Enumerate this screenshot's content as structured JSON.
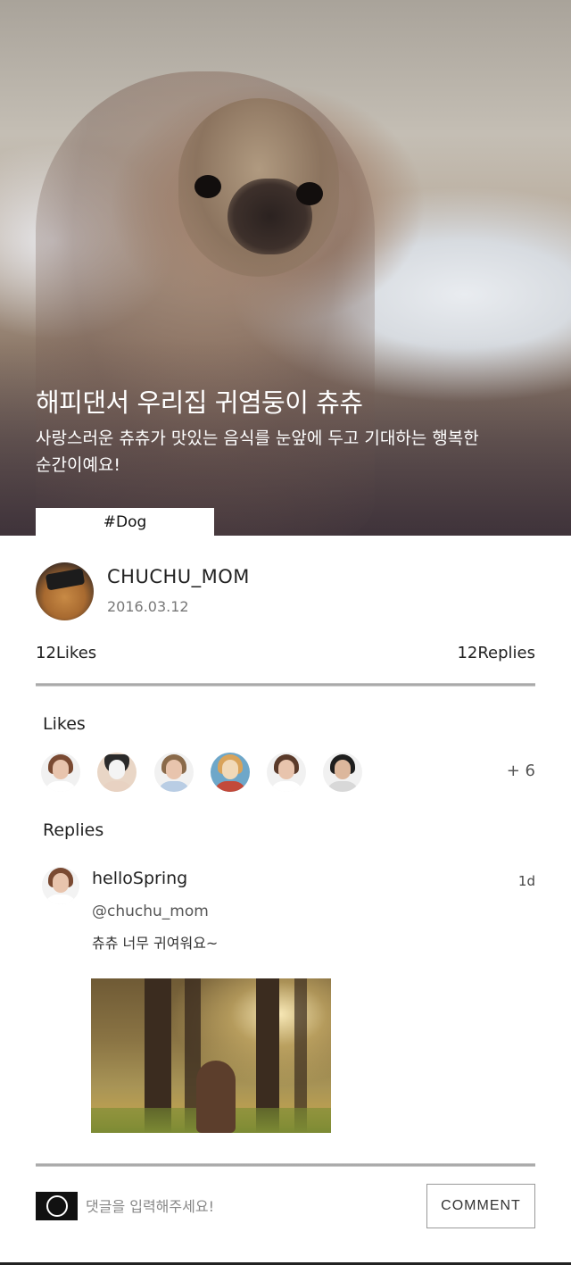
{
  "hero": {
    "title": "해피댄서 우리집 귀염둥이 츄츄",
    "description": "사랑스러운 츄츄가 맛있는 음식를 눈앞에 두고 기대하는 행복한 순간이예요!",
    "tag": "#Dog",
    "photo_icon": "pug-in-blanket-photo"
  },
  "author": {
    "name": "CHUCHU_MOM",
    "date": "2016.03.12",
    "avatar_icon": "dog-with-cap-avatar"
  },
  "counts": {
    "likes": "12Likes",
    "replies": "12Replies"
  },
  "likes_section": {
    "title": "Likes",
    "more": "+ 6",
    "avatars": [
      {
        "icon": "woman-avatar",
        "hair": "#7a4a32",
        "shirt": "#ffffff"
      },
      {
        "icon": "french-bulldog-avatar",
        "hair": "#2a2a2a",
        "shirt": "#e8d2c2"
      },
      {
        "icon": "man-avatar",
        "hair": "#8a6a4a",
        "shirt": "#b9cde4"
      },
      {
        "icon": "toy-dog-avatar",
        "hair": "#d9a35a",
        "shirt": "#c34a3a"
      },
      {
        "icon": "woman-avatar",
        "hair": "#5a3a2a",
        "shirt": "#ffffff"
      },
      {
        "icon": "man-avatar",
        "hair": "#1e1e1e",
        "shirt": "#d8d8d8"
      }
    ]
  },
  "replies_section": {
    "title": "Replies",
    "items": [
      {
        "author": "helloSpring",
        "time": "1d",
        "mention": "@chuchu_mom",
        "text": "츄츄 너무 귀여워요~",
        "image_icon": "dog-in-forest-photo",
        "avatar_icon": "woman-avatar"
      }
    ]
  },
  "comment": {
    "placeholder": "댓글을 입력해주세요!",
    "button": "COMMENT"
  }
}
